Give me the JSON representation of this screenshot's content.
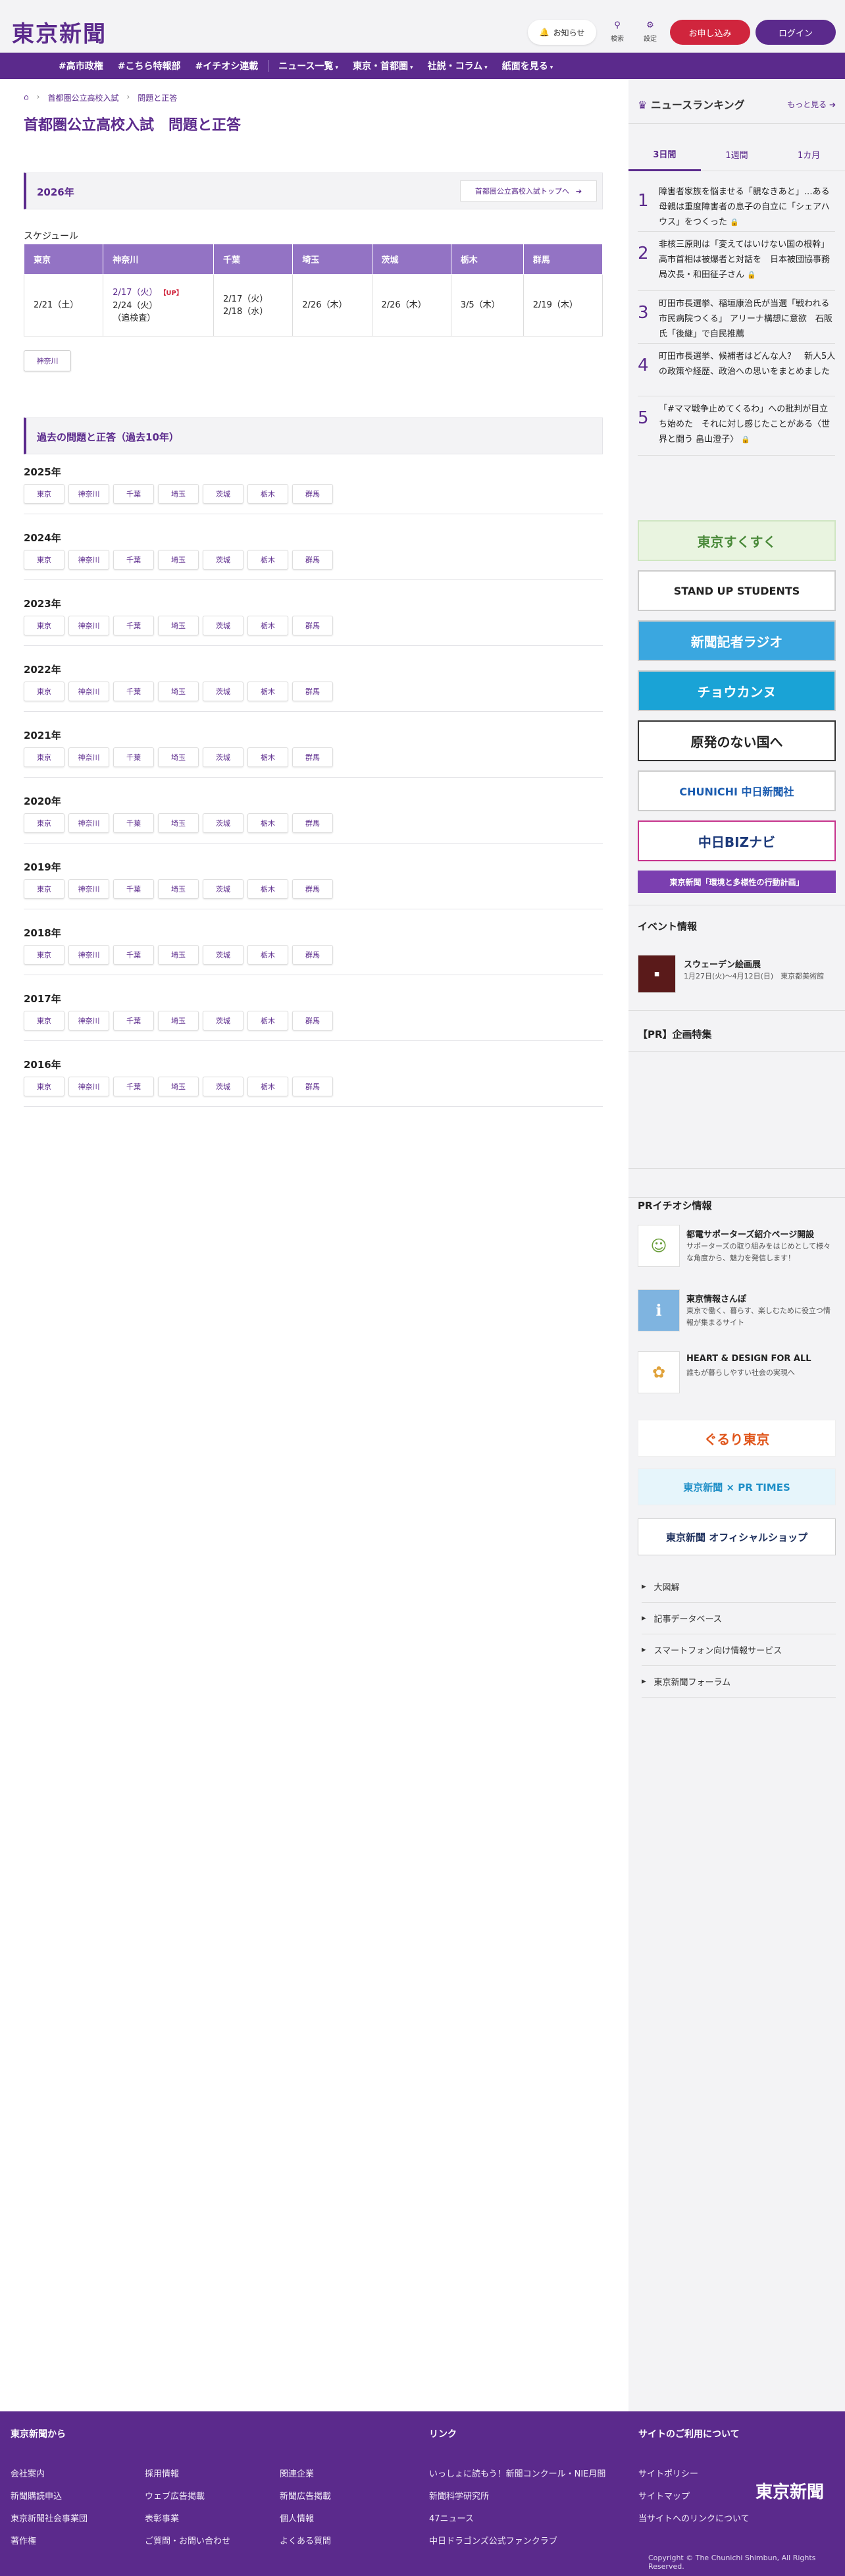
{
  "header": {
    "logo": "東京新聞",
    "notice": "お知らせ",
    "search": "検索",
    "settings": "設定",
    "subscribe": "お申し込み",
    "login": "ログイン"
  },
  "nav": [
    "#高市政権",
    "#こちら特報部",
    "#イチオシ連載",
    "ニュース一覧",
    "東京・首都圏",
    "社説・コラム",
    "紙面を見る"
  ],
  "breadcrumb": [
    "首都圏公立高校入試",
    "問題と正答"
  ],
  "page_title": "首都圏公立高校入試　問題と正答",
  "section2026": {
    "title": "2026年",
    "link": "首都圏公立高校入試トップへ"
  },
  "schedule": {
    "label": "スケジュール",
    "headers": [
      "東京",
      "神奈川",
      "千葉",
      "埼玉",
      "茨城",
      "栃木",
      "群馬"
    ],
    "kanagawa": {
      "line1": "2/17（火）",
      "up": "【UP】",
      "line2": "2/24（火）",
      "line3": "（追検査）"
    },
    "tokyo": "2/21（土）",
    "chiba": {
      "line1": "2/17（火）",
      "line2": "2/18（水）"
    },
    "saitama": "2/26（木）",
    "ibaraki": "2/26（木）",
    "tochigi": "3/5（木）",
    "gunma": "2/19（木）"
  },
  "kanagawa_button": "神奈川",
  "past": {
    "title": "過去の問題と正答（過去10年）",
    "prefs": [
      "東京",
      "神奈川",
      "千葉",
      "埼玉",
      "茨城",
      "栃木",
      "群馬"
    ],
    "years": [
      "2025年",
      "2024年",
      "2023年",
      "2022年",
      "2021年",
      "2020年",
      "2019年",
      "2018年",
      "2017年",
      "2016年"
    ]
  },
  "sidebar": {
    "ranking_title": "ニュースランキング",
    "ranking_more": "もっと見る",
    "tabs": [
      "3日間",
      "1週間",
      "1カ月"
    ],
    "ranking": [
      {
        "n": "1",
        "text": "障害者家族を悩ませる「親なきあと」…ある母親は重度障害者の息子の自立に「シェアハウス」をつくった",
        "lock": "🔒"
      },
      {
        "n": "2",
        "text": "非核三原則は「変えてはいけない国の根幹」 高市首相は被爆者と対話を　日本被団協事務局次長・和田征子さん",
        "lock": "🔒"
      },
      {
        "n": "3",
        "text": "町田市長選挙、稲垣康治氏が当選「戦われる市民病院つくる」 アリーナ構想に意欲　石阪氏「後継」で自民推薦",
        "lock": ""
      },
      {
        "n": "4",
        "text": "町田市長選挙、候補者はどんな人？　新人5人の政策や経歴、政治への思いをまとめました",
        "lock": ""
      },
      {
        "n": "5",
        "text": "「#ママ戦争止めてくるわ」への批判が目立ち始めた　それに対し感じたことがある〈世界と闘う 畠山澄子〉",
        "lock": "🔒"
      }
    ],
    "banners": [
      "東京すくすく",
      "STAND UP STUDENTS",
      "新聞記者ラジオ",
      "チョウカンヌ",
      "原発のない国へ",
      "CHUNICHI 中日新聞社",
      "中日BIZナビ",
      "東京新聞「環境と多様性の行動計画」"
    ],
    "event_title": "イベント情報",
    "event": {
      "name": "スウェーデン絵画展",
      "desc": "1月27日(火)〜4月12日(日)　東京都美術館"
    },
    "pr_title": "【PR】企画特集",
    "pr_pick_title": "PRイチオシ情報",
    "pr_items": [
      {
        "h": "都電サポーターズ紹介ページ開設",
        "d": "サポーターズの取り組みをはじめとして様々な角度から、魅力を発信します！"
      },
      {
        "h": "東京情報さんぽ",
        "d": "東京で働く、暮らす、楽しむために役立つ情報が集まるサイト"
      },
      {
        "h": "HEART & DESIGN FOR ALL",
        "d": "誰もが暮らしやすい社会の実現へ"
      }
    ],
    "banners2": [
      "ぐるり東京",
      "東京新聞 × PR TIMES",
      "東京新聞 オフィシャルショップ"
    ],
    "links": [
      "大図解",
      "記事データベース",
      "スマートフォン向け情報サービス",
      "東京新聞フォーラム"
    ]
  },
  "footer": {
    "col1_title": "東京新聞から",
    "col1": [
      "会社案内",
      "新聞購読申込",
      "東京新聞社会事業団",
      "著作権",
      "採用情報",
      "ウェブ広告掲載",
      "表彰事業",
      "ご質問・お問い合わせ",
      "関連企業",
      "新聞広告掲載",
      "個人情報",
      "よくある質問"
    ],
    "col2_title": "リンク",
    "col2": [
      "いっしょに読もう！新聞コンクール・NIE月間",
      "新聞科学研究所",
      "47ニュース",
      "中日ドラゴンズ公式ファンクラブ"
    ],
    "col3_title": "サイトのご利用について",
    "col3": [
      "サイトポリシー",
      "サイトマップ",
      "当サイトへのリンクについて"
    ],
    "logo": "東京新聞",
    "copyright": "Copyright © The Chunichi Shimbun, All Rights Reserved."
  },
  "colors": {
    "brand": "#5b2a8c",
    "accent": "#d0253d",
    "table_header": "#9373c4"
  }
}
